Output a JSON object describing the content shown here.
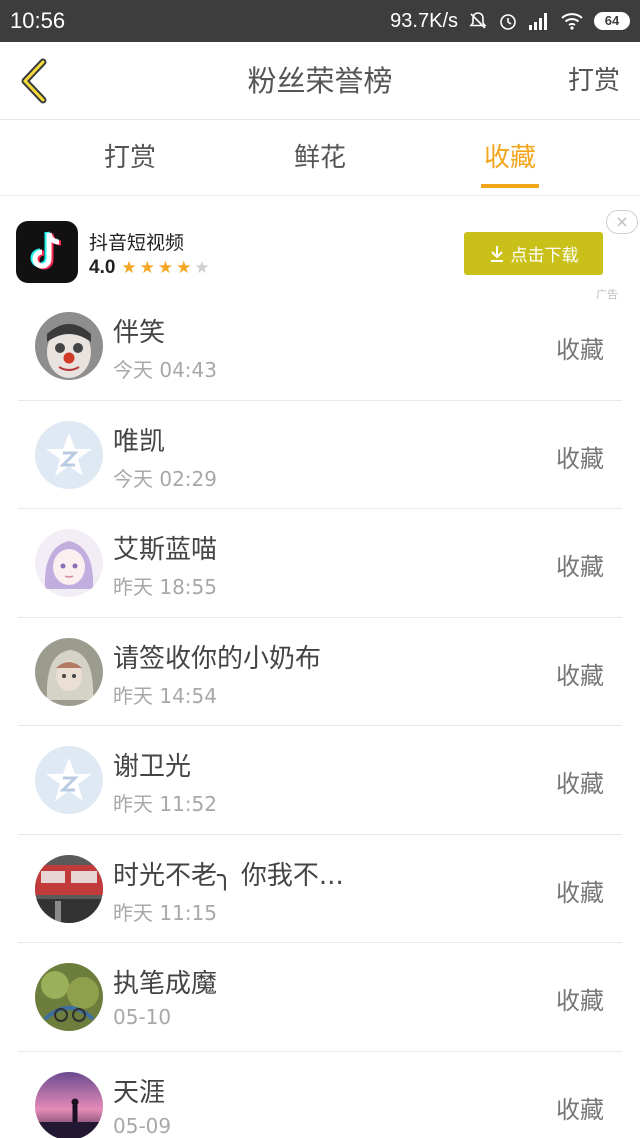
{
  "status_bar": {
    "time": "10:56",
    "network_speed": "93.7K/s",
    "battery": "64",
    "icons": [
      "mute-bell-icon",
      "alarm-icon",
      "signal-icon",
      "wifi-icon",
      "battery-icon"
    ]
  },
  "header": {
    "back_icon": "chevron-left-icon",
    "title": "粉丝荣誉榜",
    "action": "打赏"
  },
  "tabs": [
    {
      "label": "打赏",
      "active": false
    },
    {
      "label": "鲜花",
      "active": false
    },
    {
      "label": "收藏",
      "active": true
    }
  ],
  "ad": {
    "app_name": "抖音短视频",
    "rating": "4.0",
    "stars": 4,
    "button_label": "点击下载",
    "close": "×",
    "ad_label": "广告"
  },
  "list": [
    {
      "name": "伴笑",
      "time": "今天 04:43",
      "action": "收藏",
      "avatar": "clown-face-avatar"
    },
    {
      "name": "唯凯",
      "time": "今天 02:29",
      "action": "收藏",
      "avatar": "default-star-avatar"
    },
    {
      "name": "艾斯蓝喵",
      "time": "昨天 18:55",
      "action": "收藏",
      "avatar": "anime-girl-avatar"
    },
    {
      "name": "请签收你的小奶布",
      "time": "昨天 14:54",
      "action": "收藏",
      "avatar": "hooded-girl-avatar"
    },
    {
      "name": "谢卫光",
      "time": "昨天 11:52",
      "action": "收藏",
      "avatar": "default-star-avatar"
    },
    {
      "name": "时光不老╮ 你我不...",
      "time": "昨天 11:15",
      "action": "收藏",
      "avatar": "street-sign-avatar"
    },
    {
      "name": "执笔成魔",
      "time": "05-10",
      "action": "收藏",
      "avatar": "cartoon-avatar"
    },
    {
      "name": "天涯",
      "time": "05-09",
      "action": "收藏",
      "avatar": "sunset-silhouette-avatar"
    }
  ],
  "colors": {
    "accent": "#f3a51c",
    "status_bar": "#3d3d3d",
    "ad_button": "#c9c119"
  }
}
